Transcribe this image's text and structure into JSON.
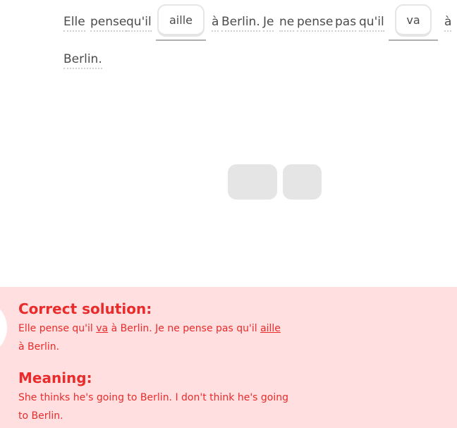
{
  "exercise": {
    "words": [
      "Elle",
      "pense",
      "qu'il",
      "à",
      "Berlin.",
      "Je",
      "ne",
      "pense",
      "pas",
      "qu'il",
      "à",
      "Berlin."
    ],
    "slot_1_answer": "aille",
    "slot_2_answer": "va"
  },
  "word_bank": {
    "tiles": [
      "",
      ""
    ]
  },
  "feedback": {
    "colors": {
      "banner_background": "#ffdfe0",
      "text": "#ea2b2b"
    },
    "solution_heading": "Correct solution:",
    "solution_line1": {
      "a": "Elle pense qu'il ",
      "b": "va",
      "c": " à Berlin. Je ne pense pas qu'il ",
      "d": "aille"
    },
    "solution_line2": "à Berlin.",
    "meaning_heading": "Meaning:",
    "meaning_line1": "She thinks he's going to Berlin. I don't think he's going",
    "meaning_line2": "to Berlin."
  }
}
